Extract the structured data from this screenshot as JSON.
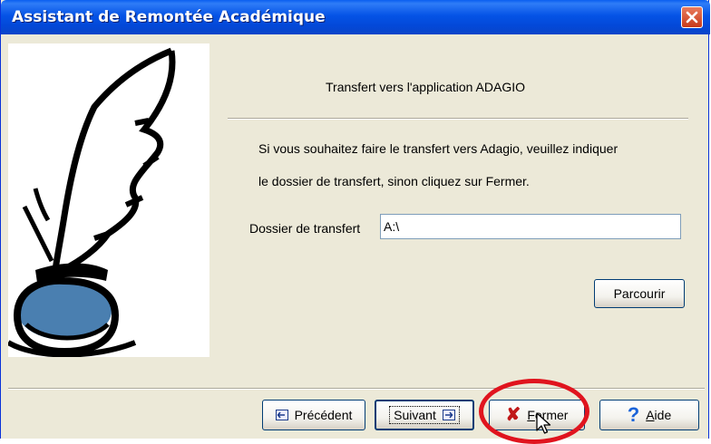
{
  "window": {
    "title": "Assistant de Remontée Académique",
    "close_icon": "close-icon"
  },
  "illustration": {
    "icon": "quill-inkwell-icon"
  },
  "main": {
    "heading": "Transfert vers l'application ADAGIO",
    "instruction_line1": "Si vous souhaitez faire le transfert vers Adagio, veuillez indiquer",
    "instruction_line2": "le dossier de transfert, sinon cliquez sur Fermer.",
    "folder_label": "Dossier de transfert",
    "folder_value": "A:\\",
    "browse_label": "Parcourir"
  },
  "footer": {
    "previous_label": "Précédent",
    "next_label": "Suivant",
    "close_prefix": "F",
    "close_rest": "ermer",
    "help_prefix": "A",
    "help_rest": "ide"
  },
  "colors": {
    "titlebar": "#0553e6",
    "highlight": "#e0141e"
  }
}
